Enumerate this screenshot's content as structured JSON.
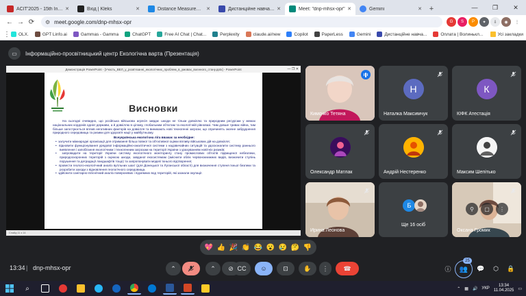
{
  "browser": {
    "tabs": [
      {
        "label": "ACIT'2025 - 15th Internati",
        "color": "#c62828",
        "active": false
      },
      {
        "label": "Вхід | Kleks",
        "color": "#212121",
        "active": false
      },
      {
        "label": "Distance Measurement usi",
        "color": "#1e88e5",
        "active": false
      },
      {
        "label": "Дистанційне навчання з",
        "color": "#3949ab",
        "active": false
      },
      {
        "label": "Meet: \"dnp-mhsx-opr\"",
        "color": "#00897b",
        "active": true
      },
      {
        "label": "Gemini",
        "color": "#4285f4",
        "active": false
      }
    ],
    "url": "meet.google.com/dnp-mhsx-opr",
    "bookmarks": [
      {
        "label": "OLX.",
        "color": "#23e5db"
      },
      {
        "label": "GPT Linfo.ai",
        "color": "#6d4c41"
      },
      {
        "label": "Gammas - Gamma",
        "color": "#7e57c2"
      },
      {
        "label": "ChatGPT",
        "color": "#10a37f"
      },
      {
        "label": "Free AI Chat | Chat...",
        "color": "#26a69a"
      },
      {
        "label": "Perplexity",
        "color": "#20808d"
      },
      {
        "label": "claude.ai/new",
        "color": "#d97757"
      },
      {
        "label": "Copilot",
        "color": "#2d7ff9"
      },
      {
        "label": "PaperLess",
        "color": "#424242"
      },
      {
        "label": "Gemini",
        "color": "#4285f4"
      },
      {
        "label": "Дистанційне навча...",
        "color": "#3949ab"
      },
      {
        "label": "Оплата | Волинькл...",
        "color": "#e53935"
      }
    ],
    "all_bookmarks": "Усі закладки"
  },
  "meet": {
    "presenting_title": "Інформаційно-просвітницький центр Екологічна варта (Презентація)",
    "clock": "13:34",
    "separator": "|",
    "code": "dnp-mhsx-opr",
    "participants_count": "25",
    "reactions": [
      "💖",
      "👍",
      "🎉",
      "👏",
      "😂",
      "😮",
      "😢",
      "🤔",
      "👎"
    ]
  },
  "presentation": {
    "window_title": "Демонстрація PowerPoint - [Участь_ВЕЛ_у_розв'язанні_екологічних_проблем_в_умовах_воєнного_стану.pptx] - PowerPoint",
    "slide_title": "Висновки",
    "paragraph": "На сьогодні очевидно, що російська військова агресія завдає шкоди не тільки довкіллю та природним ресурсам у межах національних кордонів однієї держави, а й довкіллю в цілому, глобальним об'єктам та екологічній рівновазі. Чим довше триває війна, тим більше загострюється вплив негативних факторів на довкілля та виникають нові техногенні загрози, що спричинять значне забруднення природного середовища та ризики для здоров'я нації у майбутньому.",
    "subheading": "Всеукраїнська екологічна ліга вважає за необхідне:",
    "bullets": [
      "залучити міжнародні організації для отримання більш повної та об'єктивної оцінки впливу військових дій на довкілля;",
      "відновити функціонування урядової інформаційно-аналітичної системи з надзвичайних ситуацій та удосконалити систему раннього виявлення і запобігання екологічним і техногенним загрозам на території України з урахуванням новітніх ризиків;",
      "запровадити на території України систему екологічного моніторингу стану промислових об'єктів підвищеної небезпеки, природоохоронних територій з оцінкою шкоди, завданої екосистемам (зміснити облік червонокнижних видів, визначити ступінь порушення та деградації ландшафтів тощо) та запропонувати моделі їхнього відтворення;",
      "провести геолого-екологічний аналіз вугільних шахт (для Донецької та Луганської області) для визначення ступеня їхньої безпеки та розробити заходи з відновлення геологічного середовища.",
      "здійснити санітарно-пігієнічний аналіз поверхневих і підземних вод територій, які зазнали окупації."
    ],
    "status": "Слайд 11 з 14"
  },
  "participants": [
    {
      "name": "Кимочко Тетяна",
      "type": "photo",
      "photo_color": "#d8c2b6",
      "speaking": true
    },
    {
      "name": "Наталка Максимчук",
      "type": "letter",
      "letter": "Н",
      "color": "#5c6bc0"
    },
    {
      "name": "КІФК Атестація",
      "type": "letter",
      "letter": "К",
      "color": "#7e57c2"
    },
    {
      "name": "Олександр Матлак",
      "type": "photo",
      "photo_color": "#6a1b9a"
    },
    {
      "name": "Андрій Нестеренко",
      "type": "photo",
      "photo_color": "#f9a825"
    },
    {
      "name": "Максим Шепітько",
      "type": "photo",
      "photo_color": "#e0e0e0"
    },
    {
      "name": "Ирина Леонова",
      "type": "photo",
      "photo_color": "#b0a08e"
    },
    {
      "name": "Ще 16 осіб",
      "type": "group",
      "letter": "Б",
      "color": "#1e88e5"
    },
    {
      "name": "Оксана Громик",
      "type": "photo",
      "photo_color": "#c9b8a4"
    }
  ],
  "taskbar": {
    "lang": "УКР",
    "time": "13:34",
    "date": "11.04.2025"
  }
}
